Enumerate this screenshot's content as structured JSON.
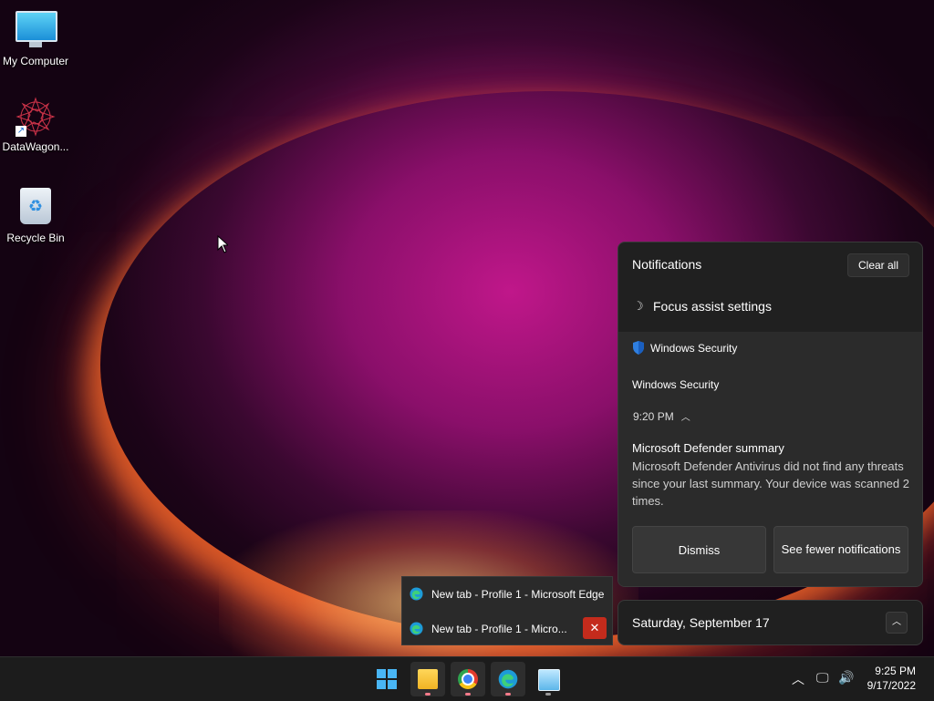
{
  "desktop": {
    "icons": [
      {
        "label": "My Computer",
        "icon": "monitor-icon"
      },
      {
        "label": "DataWagon...",
        "icon": "starburst-app-icon"
      },
      {
        "label": "Recycle Bin",
        "icon": "recycle-bin-icon"
      }
    ]
  },
  "notifications": {
    "title": "Notifications",
    "clear_all": "Clear all",
    "focus_assist": "Focus assist settings",
    "card": {
      "app_name": "Windows Security",
      "source": "Windows Security",
      "time": "9:20 PM",
      "heading": "Microsoft Defender summary",
      "body": "Microsoft Defender Antivirus did not find any threats since your last summary. Your device was scanned 2 times.",
      "dismiss": "Dismiss",
      "see_fewer": "See fewer notifications"
    }
  },
  "calendar": {
    "date": "Saturday, September 17"
  },
  "thumbnails": {
    "items": [
      {
        "title": "New tab - Profile 1 - Microsoft Edge"
      },
      {
        "title": "New tab - Profile 1 - Micro..."
      }
    ]
  },
  "taskbar": {
    "apps": [
      "start-icon",
      "file-explorer-icon",
      "chrome-icon",
      "edge-icon",
      "remote-desktop-icon"
    ],
    "clock": {
      "time": "9:25 PM",
      "date": "9/17/2022"
    }
  },
  "colors": {
    "accent": "#49b6f5",
    "close_red": "#c42b1c",
    "panel_bg": "#202020"
  }
}
